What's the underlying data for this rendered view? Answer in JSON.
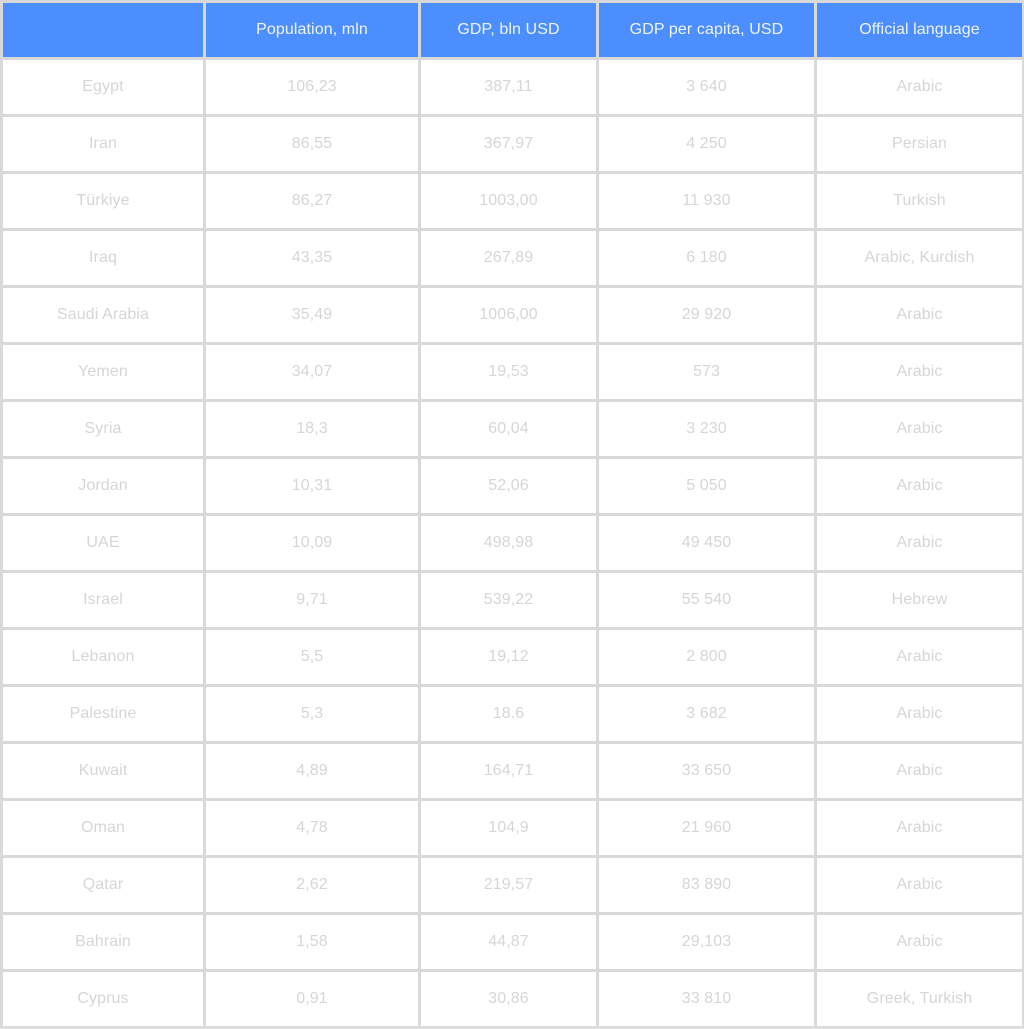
{
  "table": {
    "header": [
      "",
      "Population, mln",
      "GDP, bln USD",
      "GDP per capita, USD",
      "Official language"
    ],
    "rows": [
      [
        "Egypt",
        "106,23",
        "387,11",
        "3 640",
        "Arabic"
      ],
      [
        "Iran",
        "86,55",
        "367,97",
        "4 250",
        "Persian"
      ],
      [
        "Türkiye",
        "86,27",
        "1003,00",
        "11 930",
        "Turkish"
      ],
      [
        "Iraq",
        "43,35",
        "267,89",
        "6 180",
        "Arabic, Kurdish"
      ],
      [
        "Saudi Arabia",
        "35,49",
        "1006,00",
        "29 920",
        "Arabic"
      ],
      [
        "Yemen",
        "34,07",
        "19,53",
        "573",
        "Arabic"
      ],
      [
        "Syria",
        "18,3",
        "60,04",
        "3 230",
        "Arabic"
      ],
      [
        "Jordan",
        "10,31",
        "52,06",
        "5 050",
        "Arabic"
      ],
      [
        "UAE",
        "10,09",
        "498,98",
        "49 450",
        "Arabic"
      ],
      [
        "Israel",
        "9,71",
        "539,22",
        "55 540",
        "Hebrew"
      ],
      [
        "Lebanon",
        "5,5",
        "19,12",
        "2 800",
        "Arabic"
      ],
      [
        "Palestine",
        "5,3",
        "18.6",
        "3 682",
        "Arabic"
      ],
      [
        "Kuwait",
        "4,89",
        "164,71",
        "33 650",
        "Arabic"
      ],
      [
        "Oman",
        "4,78",
        "104,9",
        "21 960",
        "Arabic"
      ],
      [
        "Qatar",
        "2,62",
        "219,57",
        "83 890",
        "Arabic"
      ],
      [
        "Bahrain",
        "1,58",
        "44,87",
        "29,103",
        "Arabic"
      ],
      [
        "Cyprus",
        "0,91",
        "30,86",
        "33 810",
        "Greek, Turkish"
      ]
    ]
  },
  "colors": {
    "header_bg": "#4d8eff",
    "header_text": "#eef3ff",
    "cell_bg": "#ffffff",
    "cell_text": "#d6d6d6",
    "grid": "#d9d9d9"
  }
}
